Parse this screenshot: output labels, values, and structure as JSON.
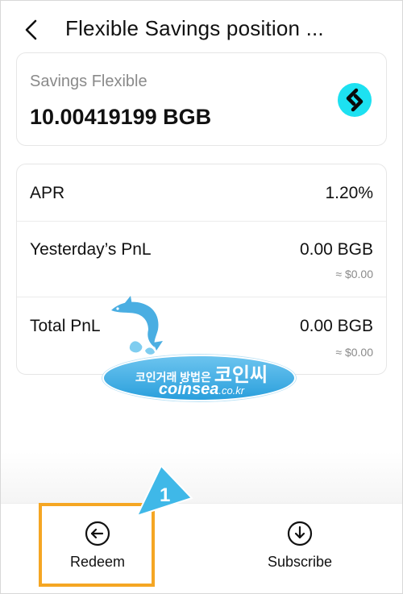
{
  "header": {
    "title": "Flexible Savings position ...",
    "back_icon": "chevron-left-icon"
  },
  "summary": {
    "label": "Savings Flexible",
    "amount": "10.00419199 BGB",
    "coin_logo": "bitget-logo",
    "logo_color": "#1de1f1"
  },
  "details": {
    "apr": {
      "label": "APR",
      "value": "1.20%"
    },
    "yesterday_pnl": {
      "label": "Yesterday’s PnL",
      "value": "0.00 BGB",
      "sub": "≈ $0.00"
    },
    "total_pnl": {
      "label": "Total PnL",
      "value": "0.00 BGB",
      "sub": "≈ $0.00"
    }
  },
  "watermark": {
    "line1_prefix": "코인거래 방법은",
    "line1_brand": "코인씨",
    "line2_domain": "coinsea",
    "line2_tld": ".co.kr"
  },
  "actions": {
    "redeem": {
      "label": "Redeem",
      "icon": "arrow-left-circle-icon"
    },
    "subscribe": {
      "label": "Subscribe",
      "icon": "arrow-down-circle-icon"
    }
  },
  "annotation": {
    "step_number": "1",
    "highlight_color": "#f5a623",
    "marker_color": "#3fb8e8"
  }
}
